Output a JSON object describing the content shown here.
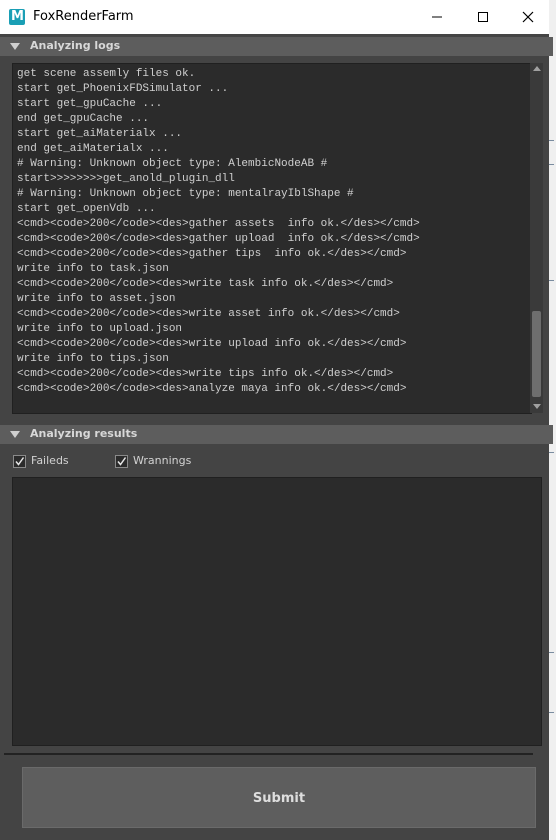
{
  "window": {
    "title": "FoxRenderFarm",
    "app_icon_letter": "M"
  },
  "sections": {
    "logs": {
      "label": "Analyzing logs"
    },
    "results": {
      "label": "Analyzing results"
    }
  },
  "logs": {
    "lines": [
      "get scene assemly files ok.",
      "start get_PhoenixFDSimulator ...",
      "start get_gpuCache ...",
      "end get_gpuCache ...",
      "start get_aiMaterialx ...",
      "end get_aiMaterialx ...",
      "# Warning: Unknown object type: AlembicNodeAB #",
      "start>>>>>>>>get_anold_plugin_dll",
      "# Warning: Unknown object type: mentalrayIblShape #",
      "start get_openVdb ...",
      "<cmd><code>200</code><des>gather assets  info ok.</des></cmd>",
      "<cmd><code>200</code><des>gather upload  info ok.</des></cmd>",
      "<cmd><code>200</code><des>gather tips  info ok.</des></cmd>",
      "write info to task.json",
      "<cmd><code>200</code><des>write task info ok.</des></cmd>",
      "write info to asset.json",
      "<cmd><code>200</code><des>write asset info ok.</des></cmd>",
      "write info to upload.json",
      "<cmd><code>200</code><des>write upload info ok.</des></cmd>",
      "write info to tips.json",
      "<cmd><code>200</code><des>write tips info ok.</des></cmd>",
      "<cmd><code>200</code><des>analyze maya info ok.</des></cmd>"
    ]
  },
  "filters": {
    "faileds": {
      "label": "Faileds",
      "checked": true
    },
    "warnings": {
      "label": "Wrannings",
      "checked": true
    }
  },
  "submit": {
    "label": "Submit"
  },
  "colors": {
    "panel_bg": "#2b2b2b",
    "window_bg": "#444444",
    "header_bg": "#5d5d5d",
    "app_icon": "#1a9fb5"
  }
}
